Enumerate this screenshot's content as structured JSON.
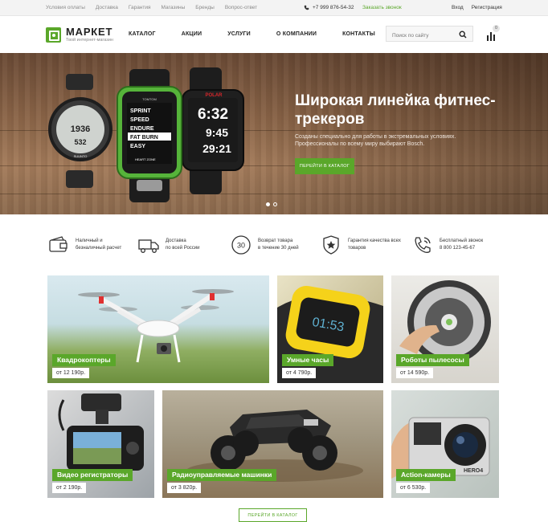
{
  "topbar": {
    "links": [
      "Условия оплаты",
      "Доставка",
      "Гарантия",
      "Магазины",
      "Бренды",
      "Вопрос-ответ"
    ],
    "phone": "+7 999 876-54-32",
    "callback": "Заказать звонок",
    "login": "Вход",
    "register": "Регистрация"
  },
  "header": {
    "logo_name": "МАРКЕТ",
    "logo_tagline": "Твой интернет-магазин",
    "nav": [
      "КАТАЛОГ",
      "АКЦИИ",
      "УСЛУГИ",
      "О КОМПАНИИ",
      "КОНТАКТЫ"
    ],
    "search_placeholder": "Поиск по сайту",
    "cart_count": "0"
  },
  "hero": {
    "title": "Широкая линейка фитнес-трекеров",
    "text": "Созданы специально для работы в экстремальных условиях. Профессионалы по всему миру выбирают Bosch.",
    "cta": "ПЕРЕЙТИ В КАТАЛОГ",
    "watch1": {
      "brand": "SUUNTO",
      "time1": "1936",
      "time2": "532"
    },
    "watch2": {
      "brand": "TOMTOM",
      "items": [
        "SPRINT",
        "SPEED",
        "ENDURE",
        "FAT BURN",
        "EASY"
      ],
      "footer": "HEART ZONE"
    },
    "watch3": {
      "brand": "POLAR",
      "time1": "6:32",
      "time2": "9:45",
      "time3": "29:21"
    }
  },
  "features": [
    {
      "line1": "Наличный и",
      "line2": "безналичный расчет"
    },
    {
      "line1": "Доставка",
      "line2": "по всей России"
    },
    {
      "line1": "Возврат товара",
      "line2": "в течение 30 дней",
      "icon_text": "30"
    },
    {
      "line1": "Гарантия качества всех",
      "line2": "товаров"
    },
    {
      "line1": "Бесплатный звонок",
      "line2": "8 800 123-45-67"
    }
  ],
  "tiles": [
    {
      "label": "Квадрокоптеры",
      "price": "от 12 190р."
    },
    {
      "label": "Умные часы",
      "price": "от 4 790р."
    },
    {
      "label": "Роботы пылесосы",
      "price": "от 14 590р."
    },
    {
      "label": "Видео регистраторы",
      "price": "от 2 190р."
    },
    {
      "label": "Радиоуправляемые машинки",
      "price": "от 3 820р."
    },
    {
      "label": "Action-камеры",
      "price": "от 6 530р."
    }
  ],
  "footer_cta": "ПЕРЕЙТИ В КАТАЛОГ",
  "colors": {
    "accent": "#5aa72a"
  }
}
